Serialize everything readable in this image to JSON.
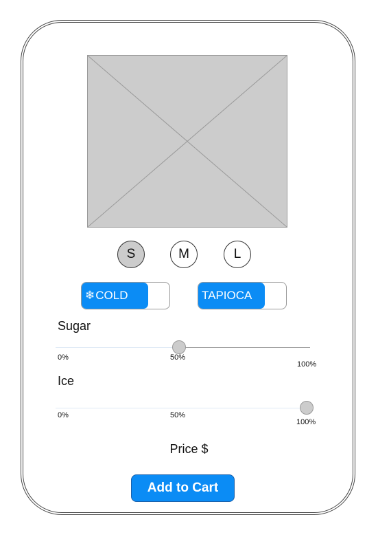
{
  "sizes": [
    {
      "label": "S",
      "selected": true
    },
    {
      "label": "M",
      "selected": false
    },
    {
      "label": "L",
      "selected": false
    }
  ],
  "toggles": {
    "cold": {
      "icon": "snowflake-icon",
      "glyph": "❄",
      "label": "COLD",
      "on": true
    },
    "tapioca": {
      "label": "TAPIOCA",
      "on": true
    }
  },
  "sugar": {
    "label": "Sugar",
    "value_percent": 50,
    "ticks": [
      "0%",
      "50%",
      "100%"
    ]
  },
  "ice": {
    "label": "Ice",
    "value_percent": 100,
    "ticks": [
      "0%",
      "50%",
      "100%"
    ]
  },
  "price": {
    "label": "Price $"
  },
  "cart": {
    "button_label": "Add to Cart"
  },
  "colors": {
    "accent": "#0b8cf5",
    "placeholder": "#cccccc"
  }
}
